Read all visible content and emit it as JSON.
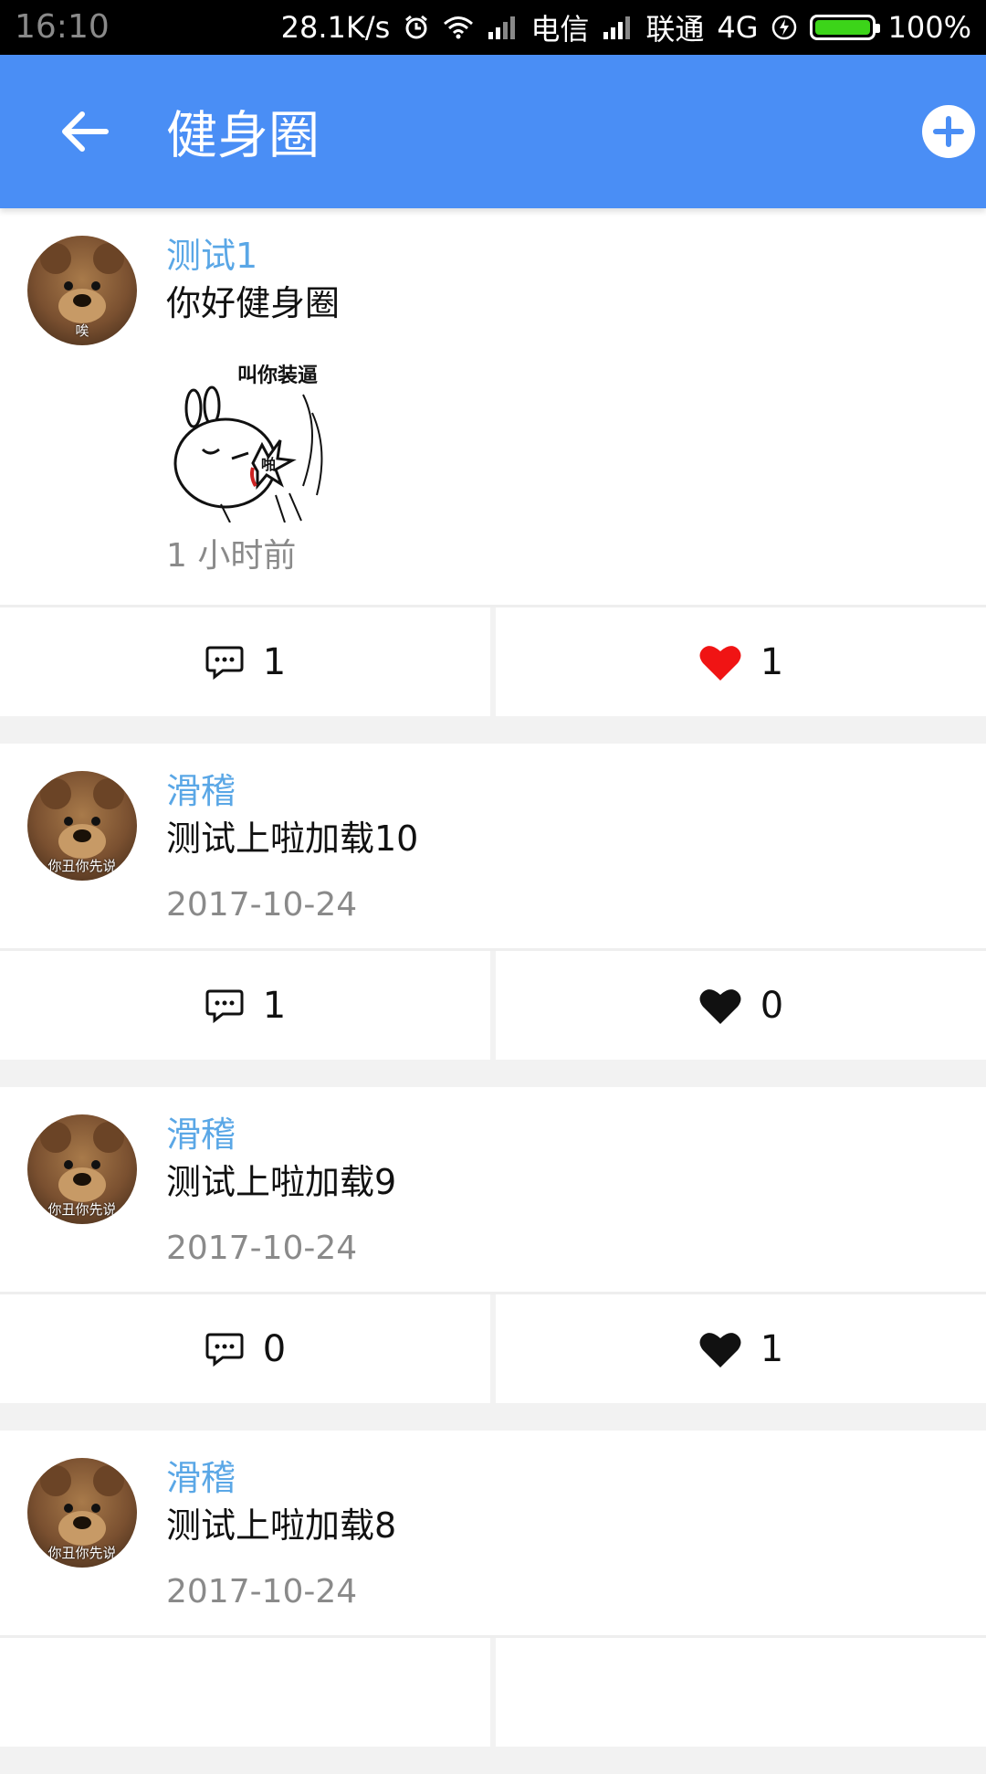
{
  "status_bar": {
    "time": "16:10",
    "network_speed": "28.1K/s",
    "carrier1": "电信",
    "carrier2": "联通",
    "network_type": "4G",
    "battery": "100%",
    "battery_level": 1.0
  },
  "appbar": {
    "title": "健身圈",
    "color": "#4a8ef5"
  },
  "posts": [
    {
      "username": "测试1",
      "content": "你好健身圈",
      "has_image": true,
      "image_caption": "叫你装逼",
      "image_sound": "啪",
      "avatar_caption": "唉",
      "time": "1 小时前",
      "comments": "1",
      "likes": "1",
      "liked": true
    },
    {
      "username": "滑稽",
      "content": "测试上啦加载10",
      "has_image": false,
      "avatar_caption": "你丑你先说",
      "time": "2017-10-24",
      "comments": "1",
      "likes": "0",
      "liked": false
    },
    {
      "username": "滑稽",
      "content": "测试上啦加载9",
      "has_image": false,
      "avatar_caption": "你丑你先说",
      "time": "2017-10-24",
      "comments": "0",
      "likes": "1",
      "liked": false
    },
    {
      "username": "滑稽",
      "content": "测试上啦加载8",
      "has_image": false,
      "avatar_caption": "你丑你先说",
      "time": "2017-10-24",
      "comments": "",
      "likes": "",
      "liked": false
    }
  ],
  "colors": {
    "username": "#5aa7e6",
    "liked_heart": "#f01414",
    "unliked_heart": "#111111"
  },
  "icons": {
    "back": "arrow-left-icon",
    "add": "plus-circle-icon",
    "comment": "comment-bubble-icon",
    "like": "heart-icon"
  }
}
